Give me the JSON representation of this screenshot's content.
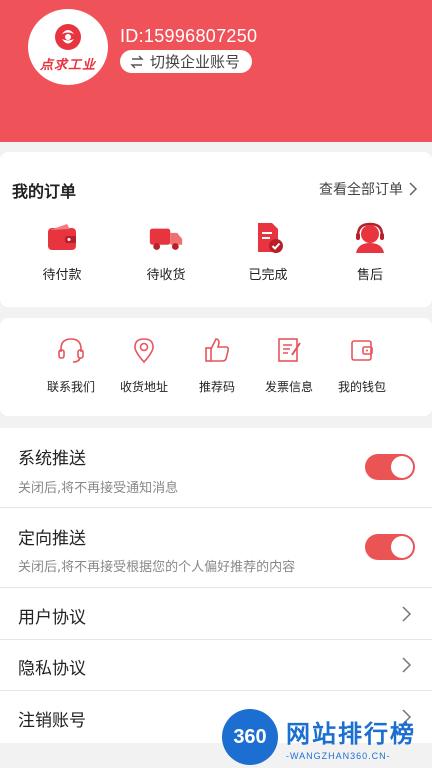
{
  "profile": {
    "logo_text": "点求工业",
    "user_id": "ID:15996807250",
    "switch_label": "切换企业账号"
  },
  "orders": {
    "title": "我的订单",
    "view_all": "查看全部订单",
    "items": [
      {
        "label": "待付款",
        "icon": "wallet-icon"
      },
      {
        "label": "待收货",
        "icon": "truck-icon"
      },
      {
        "label": "已完成",
        "icon": "document-check-icon"
      },
      {
        "label": "售后",
        "icon": "customer-service-icon"
      }
    ]
  },
  "services": {
    "items": [
      {
        "label": "联系我们",
        "icon": "headset-icon"
      },
      {
        "label": "收货地址",
        "icon": "location-pin-icon"
      },
      {
        "label": "推荐码",
        "icon": "thumbs-up-icon"
      },
      {
        "label": "发票信息",
        "icon": "invoice-icon"
      },
      {
        "label": "我的钱包",
        "icon": "wallet-outline-icon"
      }
    ]
  },
  "settings": {
    "push": {
      "title": "系统推送",
      "desc": "关闭后,将不再接受通知消息",
      "enabled": true
    },
    "targeted_push": {
      "title": "定向推送",
      "desc": "关闭后,将不再接受根据您的个人偏好推荐的内容",
      "enabled": true
    },
    "user_agreement": "用户协议",
    "privacy_agreement": "隐私协议",
    "cancel_account": "注销账号"
  },
  "watermark": {
    "badge": "360",
    "name": "网站排行榜",
    "url": "-WANGZHAN360.CN-"
  },
  "colors": {
    "brand_red": "#f0525a",
    "toggle_on": "#ea5454",
    "watermark_blue": "#1c6fd0"
  }
}
